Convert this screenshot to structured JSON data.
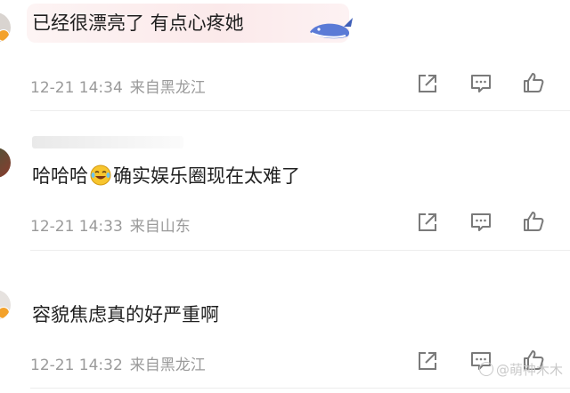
{
  "comments": [
    {
      "text": "已经很漂亮了 有点心疼她",
      "time": "12-21 14:34",
      "source": "来自黑龙江"
    },
    {
      "text_before": "哈哈哈",
      "text_after": "确实娱乐圈现在太难了",
      "emoji": "laughing-tears-emoji",
      "time": "12-21 14:33",
      "source": "来自山东"
    },
    {
      "text": "容貌焦虑真的好严重啊",
      "time": "12-21 14:32",
      "source": "来自黑龙江"
    }
  ],
  "icons": {
    "share": "share-icon",
    "comment": "comment-icon",
    "like": "thumbs-up-icon"
  },
  "watermark": "@萌神木木",
  "colors": {
    "meta_text": "#9a9a9a",
    "icon": "#7a7a7a",
    "badge": "#f3a12a"
  }
}
